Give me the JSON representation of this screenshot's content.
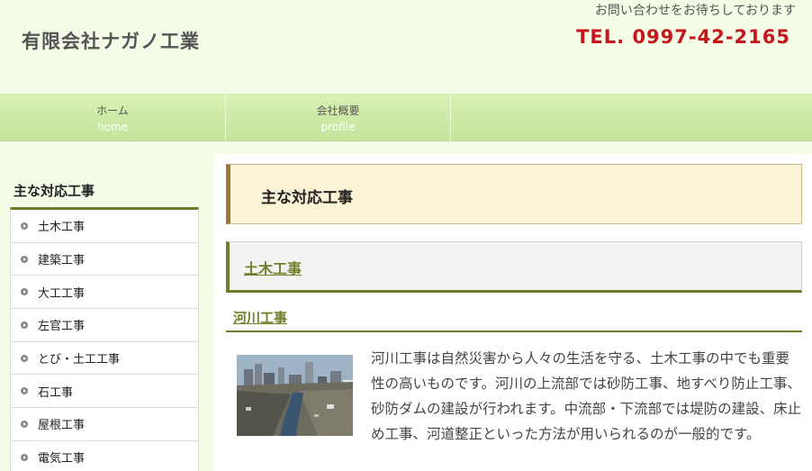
{
  "header": {
    "company_name": "有限会社ナガノ工業",
    "tagline": "お問い合わせをお待ちしております",
    "tel": "TEL. 0997-42-2165"
  },
  "nav": [
    {
      "label": "ホーム",
      "sub": "home"
    },
    {
      "label": "会社概要",
      "sub": "profile"
    }
  ],
  "sidebar": {
    "title": "主な対応工事",
    "items": [
      "土木工事",
      "建築工事",
      "大工工事",
      "左官工事",
      "とび・土工工事",
      "石工事",
      "屋根工事",
      "電気工事"
    ]
  },
  "main": {
    "page_title": "主な対応工事",
    "section_title": "土木工事",
    "subsection_title": "河川工事",
    "body": "河川工事は自然災害から人々の生活を守る、土木工事の中でも重要性の高いものです。河川の上流部では砂防工事、地すべり防止工事、砂防ダムの建設が行われます。中流部・下流部では堤防の建設、床止め工事、河道整正といった方法が用いられるのが一般的です。"
  },
  "colors": {
    "background": "#f4fbe6",
    "nav": "#c5e59a",
    "accent_green": "#6e7f2a",
    "tel_red": "#c4161c",
    "heading_bg": "#fbf3d5"
  }
}
